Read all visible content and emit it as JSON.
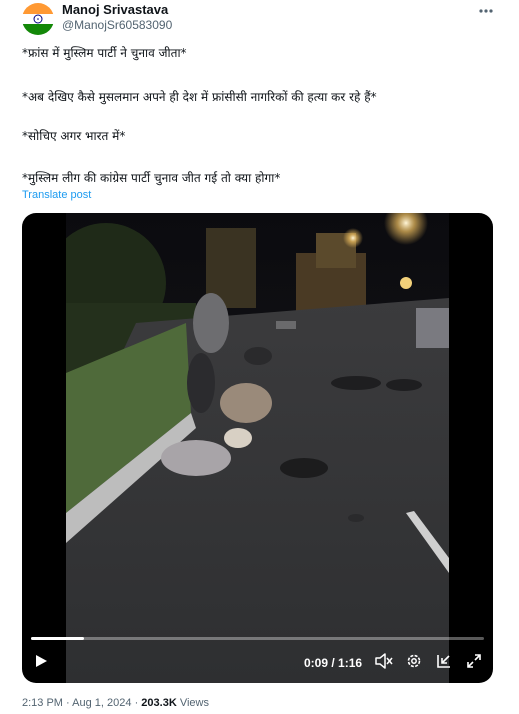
{
  "author": {
    "name": "Manoj Srivastava",
    "handle": "@ManojSr60583090"
  },
  "tweet": {
    "lines": [
      "*फ्रांस में मुस्लिम पार्टी ने चुनाव जीता*",
      "*अब देखिए कैसे मुसलमान अपने ही देश में फ्रांसीसी नागरिकों की हत्या कर रहे हैं*",
      "*सोचिए अगर भारत में*",
      "*मुस्लिम लीग की कांग्रेस पार्टी चुनाव जीत गई तो क्या होगा*"
    ],
    "translate_label": "Translate post"
  },
  "video": {
    "current_time": "0:09",
    "duration": "1:16",
    "time_display": "0:09 / 1:16",
    "progress_fraction": 0.118,
    "icons": [
      "play-icon",
      "volume-muted-icon",
      "settings-gear-icon",
      "dock-icon",
      "fullscreen-icon"
    ]
  },
  "meta": {
    "time": "2:13 PM",
    "date": "Aug 1, 2024",
    "views_count": "203.3K",
    "views_label": "Views",
    "separator": "·"
  },
  "colors": {
    "accent": "#1d9bf0",
    "secondary_text": "#536471",
    "primary_text": "#0f1419"
  }
}
